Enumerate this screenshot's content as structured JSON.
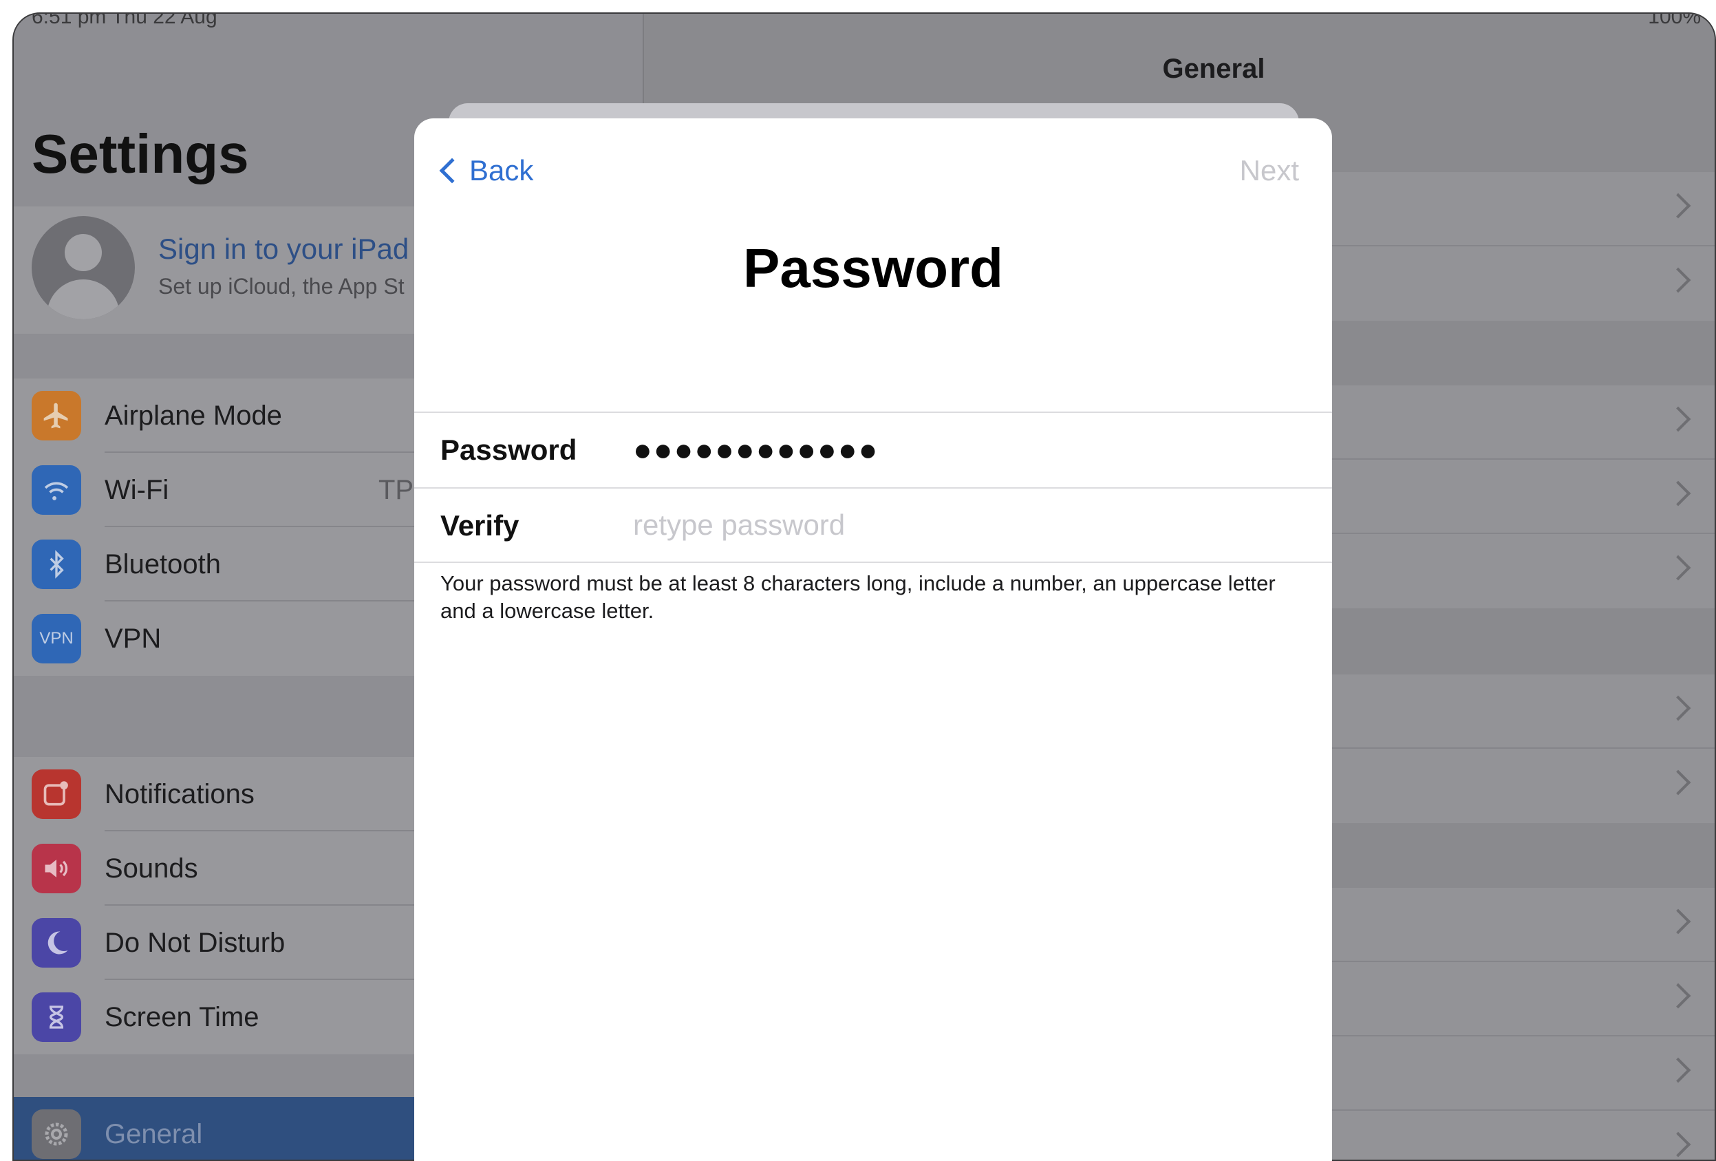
{
  "status_bar": {
    "left_text": "6:51 pm   Thu 22 Aug",
    "right_text": "100%"
  },
  "settings": {
    "title": "Settings",
    "account": {
      "title": "Sign in to your iPad",
      "subtitle": "Set up iCloud, the App St"
    },
    "group1": [
      {
        "label": "Airplane Mode",
        "icon": "airplane-icon",
        "color": "#c9782b",
        "value": ""
      },
      {
        "label": "Wi-Fi",
        "icon": "wifi-icon",
        "color": "#2f67b6",
        "value": "TP"
      },
      {
        "label": "Bluetooth",
        "icon": "bluetooth-icon",
        "color": "#2f67b6",
        "value": ""
      },
      {
        "label": "VPN",
        "icon": "vpn-icon",
        "color": "#2f67b6",
        "value": "",
        "icon_text": "VPN"
      }
    ],
    "group2": [
      {
        "label": "Notifications",
        "icon": "notifications-icon",
        "color": "#b8352f"
      },
      {
        "label": "Sounds",
        "icon": "sounds-icon",
        "color": "#b8344a"
      },
      {
        "label": "Do Not Disturb",
        "icon": "moon-icon",
        "color": "#4b46a6"
      },
      {
        "label": "Screen Time",
        "icon": "hourglass-icon",
        "color": "#4b46a6"
      }
    ],
    "group3": [
      {
        "label": "General",
        "icon": "gear-icon",
        "color": "#6e6e73"
      }
    ]
  },
  "detail": {
    "nav_title": "General"
  },
  "sheet": {
    "back_label": "Back",
    "next_label": "Next",
    "title": "Password",
    "fields": {
      "password_label": "Password",
      "password_value": "●●●●●●●●●●●●",
      "verify_label": "Verify",
      "verify_placeholder": "retype password"
    },
    "hint": "Your password must be at least 8 characters long, include a number, an uppercase letter and a lowercase letter."
  },
  "colors": {
    "accent": "#2f6fd1",
    "disabled": "#c7c7cc",
    "dim_overlay": "#8e8e93"
  }
}
